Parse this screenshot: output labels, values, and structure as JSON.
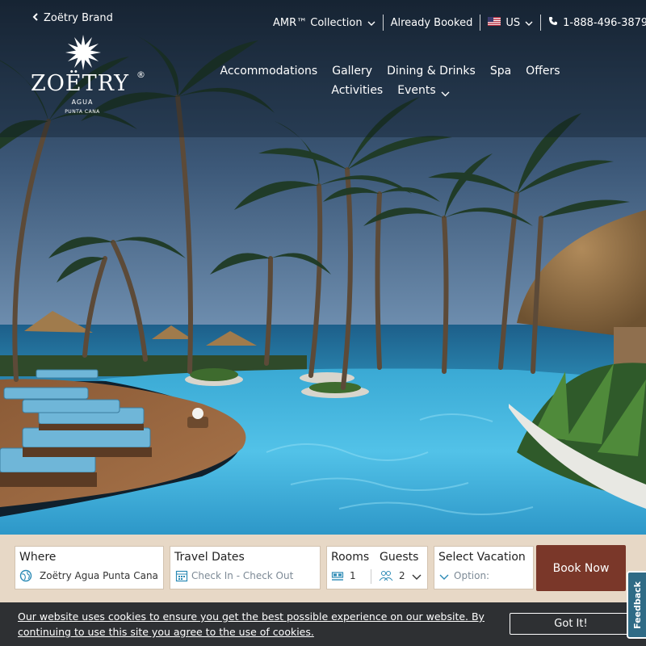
{
  "header": {
    "back_link": "Zoëtry Brand",
    "utility": {
      "collection": "AMR™ Collection",
      "already_booked": "Already Booked",
      "country": "US",
      "phone": "1-888-496-3879"
    },
    "logo": {
      "wordmark": "ZOЁTRY",
      "registered": "®",
      "sub_line1": "AGUA",
      "sub_line2": "PUNTA CANA"
    }
  },
  "nav": {
    "items": [
      "Accommodations",
      "Gallery",
      "Dining & Drinks",
      "Spa",
      "Offers",
      "Activities"
    ],
    "events": "Events"
  },
  "booking": {
    "where_label": "Where",
    "where_value": "Zoëtry Agua Punta Cana",
    "dates_label": "Travel Dates",
    "dates_placeholder": "Check In - Check Out",
    "rooms_label": "Rooms",
    "rooms_value": "1",
    "guests_label": "Guests",
    "guests_value": "2",
    "vacation_label": "Select Vacation",
    "vacation_placeholder": "Option:",
    "book_button": "Book Now"
  },
  "cookie": {
    "text": "Our website uses cookies to ensure you get the best possible experience on our website. By continuing to use this site you agree to the use of cookies.",
    "button": "Got It!"
  },
  "feedback": "Feedback",
  "colors": {
    "book_button": "#7a3729",
    "booking_bar": "#e7d8c6",
    "cookie_bar": "#2e3033",
    "feedback_tab": "#2f6b86"
  }
}
